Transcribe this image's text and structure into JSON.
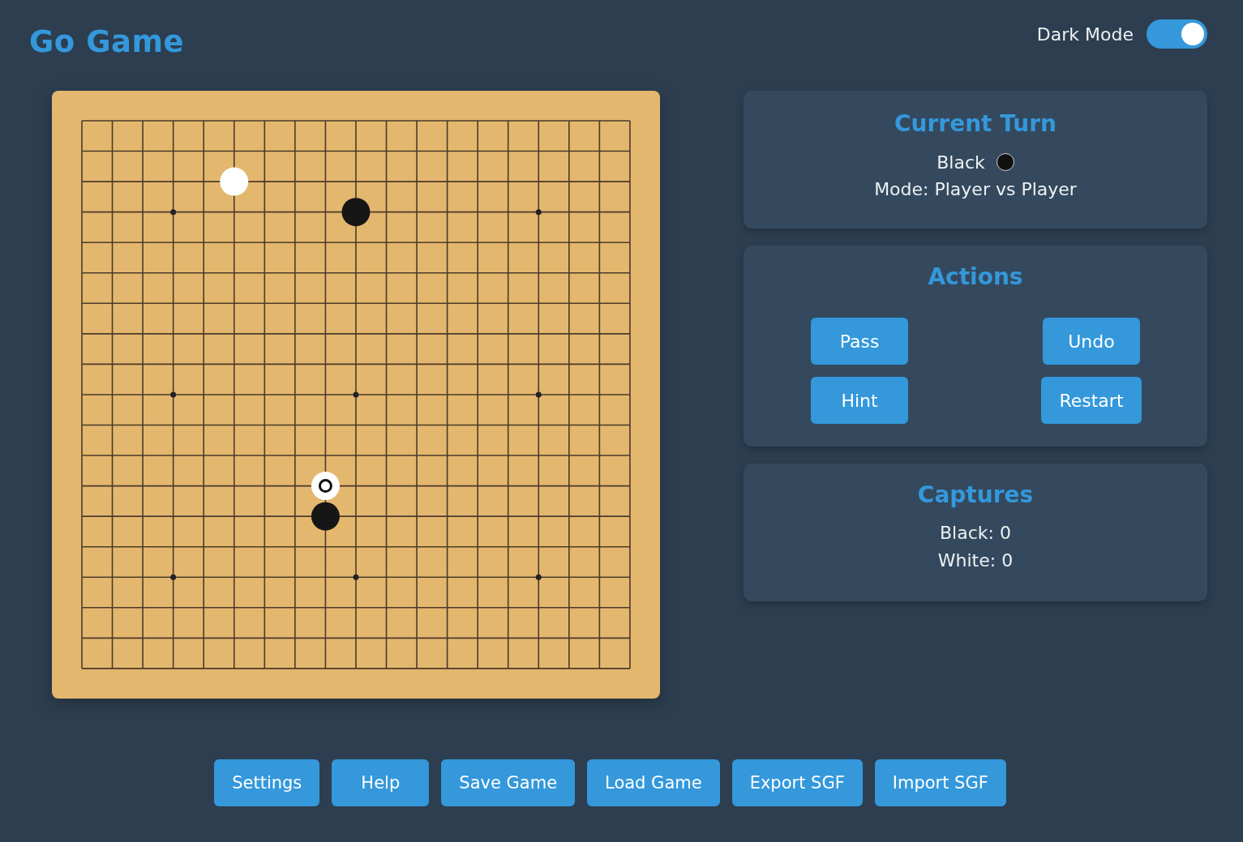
{
  "header": {
    "title": "Go Game",
    "dark_mode": {
      "label": "Dark Mode",
      "on": true
    }
  },
  "board": {
    "rows": [
      {
        "points": [
          {
            "kind": "empty"
          },
          {
            "kind": "empty"
          },
          {
            "kind": "empty"
          },
          {
            "kind": "empty"
          },
          {
            "kind": "empty"
          },
          {
            "kind": "empty"
          },
          {
            "kind": "empty"
          },
          {
            "kind": "empty"
          },
          {
            "kind": "empty"
          },
          {
            "kind": "empty"
          },
          {
            "kind": "empty"
          },
          {
            "kind": "empty"
          },
          {
            "kind": "empty"
          },
          {
            "kind": "empty"
          },
          {
            "kind": "empty"
          },
          {
            "kind": "empty"
          },
          {
            "kind": "empty"
          },
          {
            "kind": "empty"
          },
          {
            "kind": "empty"
          }
        ]
      },
      {
        "points": [
          {
            "kind": "empty"
          },
          {
            "kind": "empty"
          },
          {
            "kind": "empty"
          },
          {
            "kind": "empty"
          },
          {
            "kind": "empty"
          },
          {
            "kind": "empty"
          },
          {
            "kind": "empty"
          },
          {
            "kind": "empty"
          },
          {
            "kind": "empty"
          },
          {
            "kind": "empty"
          },
          {
            "kind": "empty"
          },
          {
            "kind": "empty"
          },
          {
            "kind": "empty"
          },
          {
            "kind": "empty"
          },
          {
            "kind": "empty"
          },
          {
            "kind": "empty"
          },
          {
            "kind": "empty"
          },
          {
            "kind": "empty"
          },
          {
            "kind": "empty"
          }
        ]
      },
      {
        "points": [
          {
            "kind": "empty"
          },
          {
            "kind": "empty"
          },
          {
            "kind": "empty"
          },
          {
            "kind": "empty"
          },
          {
            "kind": "empty"
          },
          {
            "kind": "white"
          },
          {
            "kind": "empty"
          },
          {
            "kind": "empty"
          },
          {
            "kind": "empty"
          },
          {
            "kind": "empty"
          },
          {
            "kind": "empty"
          },
          {
            "kind": "empty"
          },
          {
            "kind": "empty"
          },
          {
            "kind": "empty"
          },
          {
            "kind": "empty"
          },
          {
            "kind": "empty"
          },
          {
            "kind": "empty"
          },
          {
            "kind": "empty"
          },
          {
            "kind": "empty"
          }
        ]
      },
      {
        "points": [
          {
            "kind": "empty"
          },
          {
            "kind": "empty"
          },
          {
            "kind": "empty"
          },
          {
            "kind": "empty"
          },
          {
            "kind": "empty"
          },
          {
            "kind": "empty"
          },
          {
            "kind": "empty"
          },
          {
            "kind": "empty"
          },
          {
            "kind": "empty"
          },
          {
            "kind": "black"
          },
          {
            "kind": "empty"
          },
          {
            "kind": "empty"
          },
          {
            "kind": "empty"
          },
          {
            "kind": "empty"
          },
          {
            "kind": "empty"
          },
          {
            "kind": "empty"
          },
          {
            "kind": "empty"
          },
          {
            "kind": "empty"
          },
          {
            "kind": "empty"
          }
        ]
      },
      {
        "points": [
          {
            "kind": "empty"
          },
          {
            "kind": "empty"
          },
          {
            "kind": "empty"
          },
          {
            "kind": "empty"
          },
          {
            "kind": "empty"
          },
          {
            "kind": "empty"
          },
          {
            "kind": "empty"
          },
          {
            "kind": "empty"
          },
          {
            "kind": "empty"
          },
          {
            "kind": "empty"
          },
          {
            "kind": "empty"
          },
          {
            "kind": "empty"
          },
          {
            "kind": "empty"
          },
          {
            "kind": "empty"
          },
          {
            "kind": "empty"
          },
          {
            "kind": "empty"
          },
          {
            "kind": "empty"
          },
          {
            "kind": "empty"
          },
          {
            "kind": "empty"
          }
        ]
      },
      {
        "points": [
          {
            "kind": "empty"
          },
          {
            "kind": "empty"
          },
          {
            "kind": "empty"
          },
          {
            "kind": "empty"
          },
          {
            "kind": "empty"
          },
          {
            "kind": "empty"
          },
          {
            "kind": "empty"
          },
          {
            "kind": "empty"
          },
          {
            "kind": "empty"
          },
          {
            "kind": "empty"
          },
          {
            "kind": "empty"
          },
          {
            "kind": "empty"
          },
          {
            "kind": "empty"
          },
          {
            "kind": "empty"
          },
          {
            "kind": "empty"
          },
          {
            "kind": "empty"
          },
          {
            "kind": "empty"
          },
          {
            "kind": "empty"
          },
          {
            "kind": "empty"
          }
        ]
      },
      {
        "points": [
          {
            "kind": "empty"
          },
          {
            "kind": "empty"
          },
          {
            "kind": "empty"
          },
          {
            "kind": "empty"
          },
          {
            "kind": "empty"
          },
          {
            "kind": "empty"
          },
          {
            "kind": "empty"
          },
          {
            "kind": "empty"
          },
          {
            "kind": "empty"
          },
          {
            "kind": "empty"
          },
          {
            "kind": "empty"
          },
          {
            "kind": "empty"
          },
          {
            "kind": "empty"
          },
          {
            "kind": "empty"
          },
          {
            "kind": "empty"
          },
          {
            "kind": "empty"
          },
          {
            "kind": "empty"
          },
          {
            "kind": "empty"
          },
          {
            "kind": "empty"
          }
        ]
      },
      {
        "points": [
          {
            "kind": "empty"
          },
          {
            "kind": "empty"
          },
          {
            "kind": "empty"
          },
          {
            "kind": "empty"
          },
          {
            "kind": "empty"
          },
          {
            "kind": "empty"
          },
          {
            "kind": "empty"
          },
          {
            "kind": "empty"
          },
          {
            "kind": "empty"
          },
          {
            "kind": "empty"
          },
          {
            "kind": "empty"
          },
          {
            "kind": "empty"
          },
          {
            "kind": "empty"
          },
          {
            "kind": "empty"
          },
          {
            "kind": "empty"
          },
          {
            "kind": "empty"
          },
          {
            "kind": "empty"
          },
          {
            "kind": "empty"
          },
          {
            "kind": "empty"
          }
        ]
      },
      {
        "points": [
          {
            "kind": "empty"
          },
          {
            "kind": "empty"
          },
          {
            "kind": "empty"
          },
          {
            "kind": "empty"
          },
          {
            "kind": "empty"
          },
          {
            "kind": "empty"
          },
          {
            "kind": "empty"
          },
          {
            "kind": "empty"
          },
          {
            "kind": "empty"
          },
          {
            "kind": "empty"
          },
          {
            "kind": "empty"
          },
          {
            "kind": "empty"
          },
          {
            "kind": "empty"
          },
          {
            "kind": "empty"
          },
          {
            "kind": "empty"
          },
          {
            "kind": "empty"
          },
          {
            "kind": "empty"
          },
          {
            "kind": "empty"
          },
          {
            "kind": "empty"
          }
        ]
      },
      {
        "points": [
          {
            "kind": "empty"
          },
          {
            "kind": "empty"
          },
          {
            "kind": "empty"
          },
          {
            "kind": "empty"
          },
          {
            "kind": "empty"
          },
          {
            "kind": "empty"
          },
          {
            "kind": "empty"
          },
          {
            "kind": "empty"
          },
          {
            "kind": "empty"
          },
          {
            "kind": "empty"
          },
          {
            "kind": "empty"
          },
          {
            "kind": "empty"
          },
          {
            "kind": "empty"
          },
          {
            "kind": "empty"
          },
          {
            "kind": "empty"
          },
          {
            "kind": "empty"
          },
          {
            "kind": "empty"
          },
          {
            "kind": "empty"
          },
          {
            "kind": "empty"
          }
        ]
      },
      {
        "points": [
          {
            "kind": "empty"
          },
          {
            "kind": "empty"
          },
          {
            "kind": "empty"
          },
          {
            "kind": "empty"
          },
          {
            "kind": "empty"
          },
          {
            "kind": "empty"
          },
          {
            "kind": "empty"
          },
          {
            "kind": "empty"
          },
          {
            "kind": "empty"
          },
          {
            "kind": "empty"
          },
          {
            "kind": "empty"
          },
          {
            "kind": "empty"
          },
          {
            "kind": "empty"
          },
          {
            "kind": "empty"
          },
          {
            "kind": "empty"
          },
          {
            "kind": "empty"
          },
          {
            "kind": "empty"
          },
          {
            "kind": "empty"
          },
          {
            "kind": "empty"
          }
        ]
      },
      {
        "points": [
          {
            "kind": "empty"
          },
          {
            "kind": "empty"
          },
          {
            "kind": "empty"
          },
          {
            "kind": "empty"
          },
          {
            "kind": "empty"
          },
          {
            "kind": "empty"
          },
          {
            "kind": "empty"
          },
          {
            "kind": "empty"
          },
          {
            "kind": "empty"
          },
          {
            "kind": "empty"
          },
          {
            "kind": "empty"
          },
          {
            "kind": "empty"
          },
          {
            "kind": "empty"
          },
          {
            "kind": "empty"
          },
          {
            "kind": "empty"
          },
          {
            "kind": "empty"
          },
          {
            "kind": "empty"
          },
          {
            "kind": "empty"
          },
          {
            "kind": "empty"
          }
        ]
      },
      {
        "points": [
          {
            "kind": "empty"
          },
          {
            "kind": "empty"
          },
          {
            "kind": "empty"
          },
          {
            "kind": "empty"
          },
          {
            "kind": "empty"
          },
          {
            "kind": "empty"
          },
          {
            "kind": "empty"
          },
          {
            "kind": "empty"
          },
          {
            "kind": "white_last"
          },
          {
            "kind": "empty"
          },
          {
            "kind": "empty"
          },
          {
            "kind": "empty"
          },
          {
            "kind": "empty"
          },
          {
            "kind": "empty"
          },
          {
            "kind": "empty"
          },
          {
            "kind": "empty"
          },
          {
            "kind": "empty"
          },
          {
            "kind": "empty"
          },
          {
            "kind": "empty"
          }
        ]
      },
      {
        "points": [
          {
            "kind": "empty"
          },
          {
            "kind": "empty"
          },
          {
            "kind": "empty"
          },
          {
            "kind": "empty"
          },
          {
            "kind": "empty"
          },
          {
            "kind": "empty"
          },
          {
            "kind": "empty"
          },
          {
            "kind": "empty"
          },
          {
            "kind": "black"
          },
          {
            "kind": "empty"
          },
          {
            "kind": "empty"
          },
          {
            "kind": "empty"
          },
          {
            "kind": "empty"
          },
          {
            "kind": "empty"
          },
          {
            "kind": "empty"
          },
          {
            "kind": "empty"
          },
          {
            "kind": "empty"
          },
          {
            "kind": "empty"
          },
          {
            "kind": "empty"
          }
        ]
      },
      {
        "points": [
          {
            "kind": "empty"
          },
          {
            "kind": "empty"
          },
          {
            "kind": "empty"
          },
          {
            "kind": "empty"
          },
          {
            "kind": "empty"
          },
          {
            "kind": "empty"
          },
          {
            "kind": "empty"
          },
          {
            "kind": "empty"
          },
          {
            "kind": "empty"
          },
          {
            "kind": "empty"
          },
          {
            "kind": "empty"
          },
          {
            "kind": "empty"
          },
          {
            "kind": "empty"
          },
          {
            "kind": "empty"
          },
          {
            "kind": "empty"
          },
          {
            "kind": "empty"
          },
          {
            "kind": "empty"
          },
          {
            "kind": "empty"
          },
          {
            "kind": "empty"
          }
        ]
      },
      {
        "points": [
          {
            "kind": "empty"
          },
          {
            "kind": "empty"
          },
          {
            "kind": "empty"
          },
          {
            "kind": "empty"
          },
          {
            "kind": "empty"
          },
          {
            "kind": "empty"
          },
          {
            "kind": "empty"
          },
          {
            "kind": "empty"
          },
          {
            "kind": "empty"
          },
          {
            "kind": "empty"
          },
          {
            "kind": "empty"
          },
          {
            "kind": "empty"
          },
          {
            "kind": "empty"
          },
          {
            "kind": "empty"
          },
          {
            "kind": "empty"
          },
          {
            "kind": "empty"
          },
          {
            "kind": "empty"
          },
          {
            "kind": "empty"
          },
          {
            "kind": "empty"
          }
        ]
      },
      {
        "points": [
          {
            "kind": "empty"
          },
          {
            "kind": "empty"
          },
          {
            "kind": "empty"
          },
          {
            "kind": "empty"
          },
          {
            "kind": "empty"
          },
          {
            "kind": "empty"
          },
          {
            "kind": "empty"
          },
          {
            "kind": "empty"
          },
          {
            "kind": "empty"
          },
          {
            "kind": "empty"
          },
          {
            "kind": "empty"
          },
          {
            "kind": "empty"
          },
          {
            "kind": "empty"
          },
          {
            "kind": "empty"
          },
          {
            "kind": "empty"
          },
          {
            "kind": "empty"
          },
          {
            "kind": "empty"
          },
          {
            "kind": "empty"
          },
          {
            "kind": "empty"
          }
        ]
      },
      {
        "points": [
          {
            "kind": "empty"
          },
          {
            "kind": "empty"
          },
          {
            "kind": "empty"
          },
          {
            "kind": "empty"
          },
          {
            "kind": "empty"
          },
          {
            "kind": "empty"
          },
          {
            "kind": "empty"
          },
          {
            "kind": "empty"
          },
          {
            "kind": "empty"
          },
          {
            "kind": "empty"
          },
          {
            "kind": "empty"
          },
          {
            "kind": "empty"
          },
          {
            "kind": "empty"
          },
          {
            "kind": "empty"
          },
          {
            "kind": "empty"
          },
          {
            "kind": "empty"
          },
          {
            "kind": "empty"
          },
          {
            "kind": "empty"
          },
          {
            "kind": "empty"
          }
        ]
      },
      {
        "points": [
          {
            "kind": "empty"
          },
          {
            "kind": "empty"
          },
          {
            "kind": "empty"
          },
          {
            "kind": "empty"
          },
          {
            "kind": "empty"
          },
          {
            "kind": "empty"
          },
          {
            "kind": "empty"
          },
          {
            "kind": "empty"
          },
          {
            "kind": "empty"
          },
          {
            "kind": "empty"
          },
          {
            "kind": "empty"
          },
          {
            "kind": "empty"
          },
          {
            "kind": "empty"
          },
          {
            "kind": "empty"
          },
          {
            "kind": "empty"
          },
          {
            "kind": "empty"
          },
          {
            "kind": "empty"
          },
          {
            "kind": "empty"
          },
          {
            "kind": "empty"
          }
        ]
      }
    ]
  },
  "current_turn": {
    "title": "Current Turn",
    "player": "Black",
    "kind": "black",
    "mode": "Mode: Player vs Player"
  },
  "actions": {
    "title": "Actions",
    "buttons": [
      "Pass",
      "Undo",
      "Hint",
      "Restart"
    ]
  },
  "captures": {
    "title": "Captures",
    "lines": [
      "Black: 0",
      "White: 0"
    ]
  },
  "footer_buttons": [
    "Settings",
    "Help",
    "Save Game",
    "Load Game",
    "Export SGF",
    "Import SGF"
  ]
}
